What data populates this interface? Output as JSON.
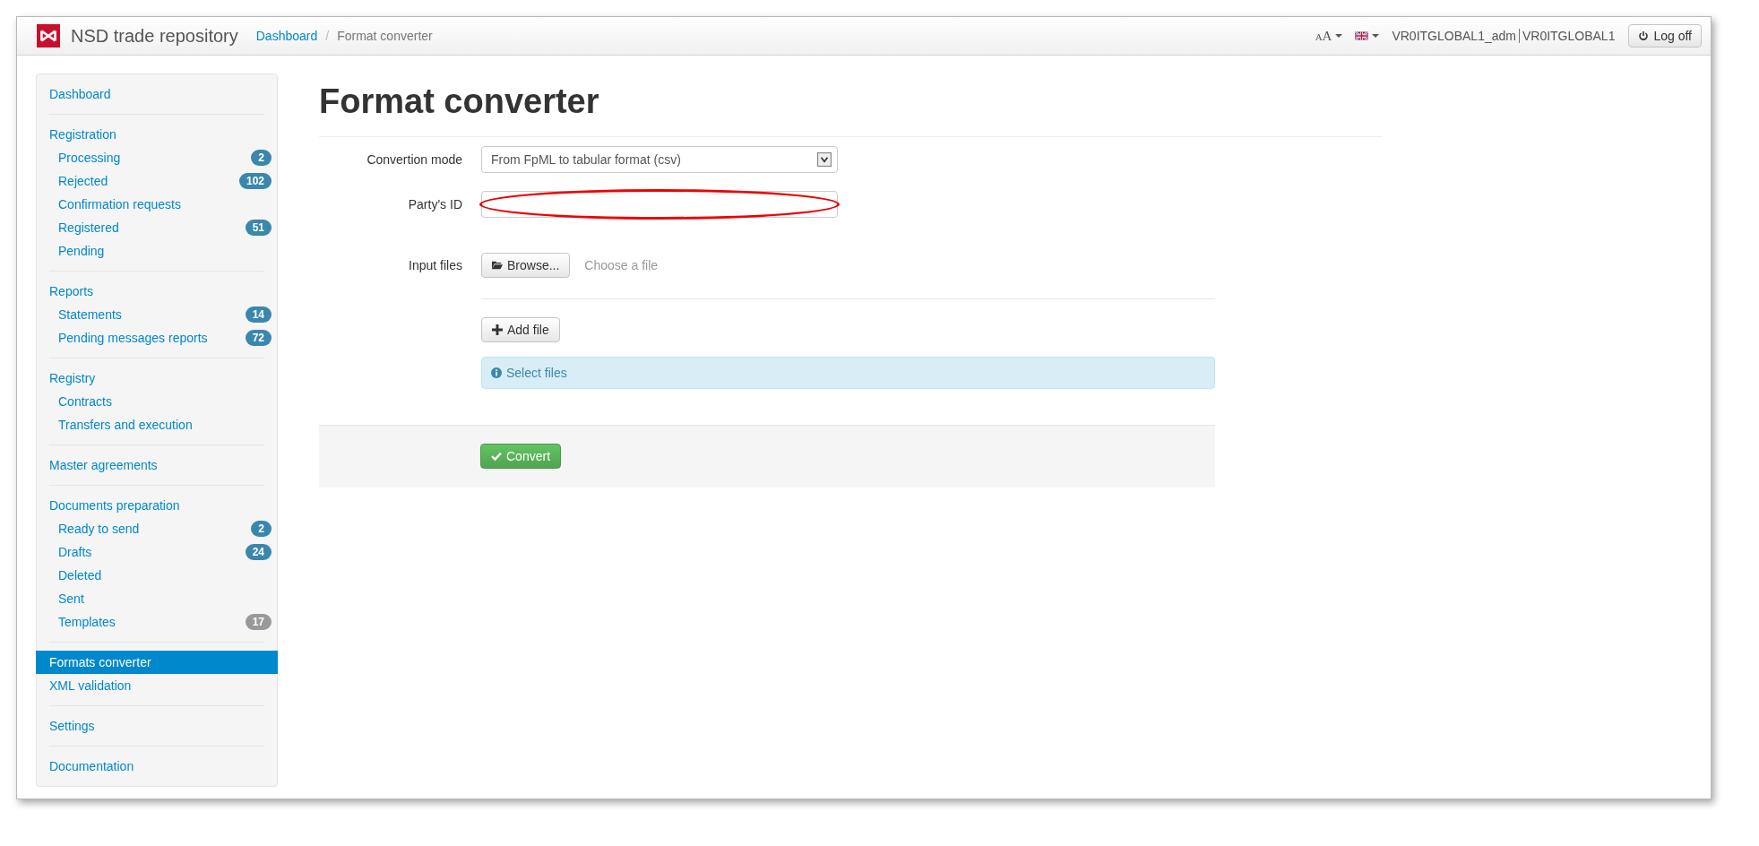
{
  "header": {
    "brand": "NSD trade repository",
    "breadcrumb_separator": "/",
    "breadcrumbs": [
      {
        "label": "Dashboard",
        "current": false
      },
      {
        "label": "Format converter",
        "current": true
      }
    ],
    "font_size_menu": {
      "small": "A",
      "large": "A"
    },
    "user": "VR0ITGLOBAL1_adm",
    "account": "VR0ITGLOBAL1",
    "logoff_button": "Log off"
  },
  "sidebar": {
    "groups": [
      [
        {
          "label": "Dashboard",
          "selected": false
        }
      ],
      [
        {
          "label": "Registration",
          "selected": false,
          "children": [
            {
              "label": "Processing",
              "selected": false,
              "badge": "2",
              "color": "#3a87ad"
            },
            {
              "label": "Rejected",
              "selected": false,
              "badge": "102",
              "color": "#3a87ad"
            },
            {
              "label": "Confirmation requests",
              "selected": false
            },
            {
              "label": "Registered",
              "selected": false,
              "badge": "51",
              "color": "#3a87ad"
            },
            {
              "label": "Pending",
              "selected": false
            }
          ]
        }
      ],
      [
        {
          "label": "Reports",
          "selected": false,
          "children": [
            {
              "label": "Statements",
              "selected": false,
              "badge": "14",
              "color": "#3a87ad"
            },
            {
              "label": "Pending messages reports",
              "selected": false,
              "badge": "72",
              "color": "#3a87ad"
            }
          ]
        }
      ],
      [
        {
          "label": "Registry",
          "selected": false,
          "children": [
            {
              "label": "Contracts",
              "selected": false
            },
            {
              "label": "Transfers and execution",
              "selected": false
            }
          ]
        }
      ],
      [
        {
          "label": "Master agreements",
          "selected": false
        }
      ],
      [
        {
          "label": "Documents preparation",
          "selected": false,
          "children": [
            {
              "label": "Ready to send",
              "selected": false,
              "badge": "2",
              "color": "#3a87ad"
            },
            {
              "label": "Drafts",
              "selected": false,
              "badge": "24",
              "color": "#3a87ad"
            },
            {
              "label": "Deleted",
              "selected": false
            },
            {
              "label": "Sent",
              "selected": false
            },
            {
              "label": "Templates",
              "selected": false,
              "badge": "17",
              "color": "#999999"
            }
          ]
        }
      ],
      [
        {
          "label": "Formats converter",
          "selected": true
        },
        {
          "label": "XML validation",
          "selected": false
        }
      ],
      [
        {
          "label": "Settings",
          "selected": false
        }
      ],
      [
        {
          "label": "Documentation",
          "selected": false
        }
      ]
    ]
  },
  "page": {
    "title": "Format converter",
    "fields": [
      {
        "kind": "select",
        "label": "Convertion mode",
        "value": "From FpML to tabular format (csv)",
        "highlighted": false
      },
      {
        "kind": "text",
        "label": "Party's ID",
        "highlighted": true
      },
      {
        "kind": "file",
        "label": "Input files",
        "button": "Browse...",
        "file_status": "Choose a file",
        "highlighted": false
      }
    ],
    "add_file_button": "Add file",
    "alert": "Select files",
    "convert_button": "Convert"
  }
}
